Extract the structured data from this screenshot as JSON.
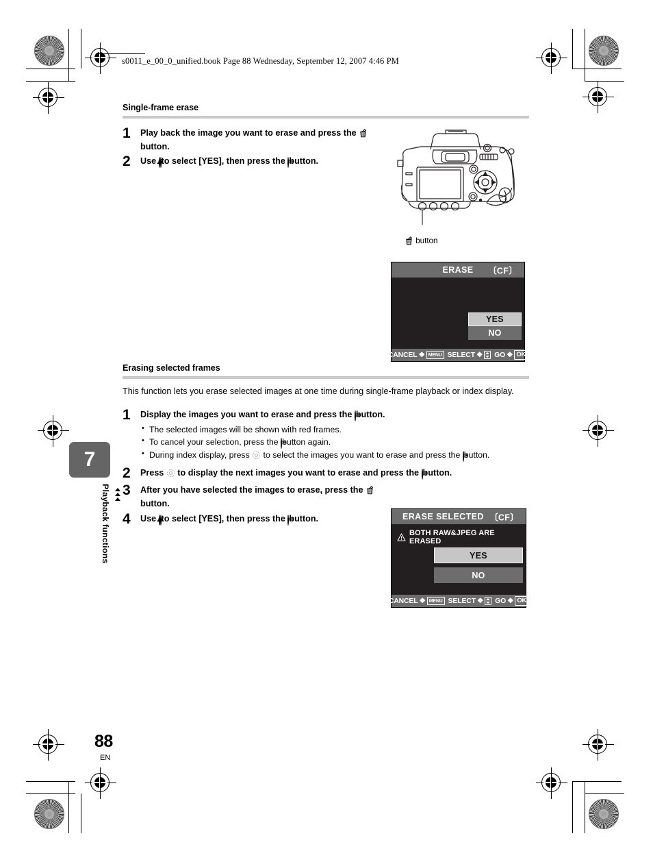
{
  "print_header": {
    "book_line": "s0011_e_00_0_unified.book  Page 88  Wednesday, September 12, 2007  4:46 PM"
  },
  "sections": [
    {
      "heading": "Single-frame erase",
      "steps": [
        {
          "num": "1",
          "text_before_icon": "Play back the image you want to erase and press the ",
          "icon": "trash-erase-icon",
          "text_after_icon": " button."
        },
        {
          "num": "2",
          "text_before_icon": "Use ",
          "icons": [
            "up-arrow-dial-icon",
            "down-arrow-dial-icon"
          ],
          "text_mid": " to select [YES], then press the ",
          "icon_end": "ok-button-icon",
          "text_after_icon": " button."
        }
      ]
    },
    {
      "heading": "Erasing selected frames",
      "intro": "This function lets you erase selected images at one time during single-frame playback or index display.",
      "steps": [
        {
          "num": "1",
          "text_before_icon": "Display the images you want to erase and press the ",
          "icon": "ok-button-icon",
          "text_after_icon": " button."
        },
        {
          "num": "2",
          "text_before_icon": "Press ",
          "icon": "arrow-pad-icon",
          "text_mid": " to display the next images you want to erase and press the ",
          "icon_end": "ok-button-icon",
          "text_after_icon": " button."
        },
        {
          "num": "3",
          "text_before_icon": "After you have selected the images to erase, press the ",
          "icon": "trash-erase-icon",
          "text_after_icon": " button."
        },
        {
          "num": "4",
          "text_before_icon": "Use ",
          "icons": [
            "up-arrow-dial-icon",
            "down-arrow-dial-icon"
          ],
          "text_mid": " to select [YES], then press the ",
          "icon_end": "ok-button-icon",
          "text_after_icon": " button."
        }
      ],
      "bullets": [
        {
          "text_before_icon": "The selected images will be shown with red frames.",
          "icon": null,
          "text_after_icon": ""
        },
        {
          "text_before_icon": "To cancel your selection, press the ",
          "icon": "ok-button-icon",
          "text_after_icon": " button again."
        },
        {
          "text_before_icon": "During index display, press ",
          "icon": "arrow-pad-icon",
          "text_mid": " to select the images you want to erase and press the ",
          "icon_end": "ok-button-icon",
          "text_after_icon": " button."
        }
      ]
    }
  ],
  "camera_figure": {
    "caption_icon": "trash-erase-icon",
    "caption_text": " button"
  },
  "lcd_screens": [
    {
      "id": "erase",
      "title": "ERASE",
      "media_badge": "CF",
      "warning": null,
      "choices": [
        {
          "label": "YES",
          "selected": true
        },
        {
          "label": "NO",
          "selected": false
        }
      ],
      "bottom_bar": [
        {
          "label": "CANCEL",
          "arrow": "❖",
          "chip": "MENU"
        },
        {
          "label": "SELECT",
          "arrow": "❖",
          "chip": "updown"
        },
        {
          "label": "GO",
          "arrow": "❖",
          "chip": "OK"
        }
      ]
    },
    {
      "id": "erase-selected",
      "title": "ERASE SELECTED",
      "media_badge": "CF",
      "warning": "BOTH RAW&JPEG ARE  ERASED",
      "warning_icon": "warning-triangle-icon",
      "choices": [
        {
          "label": "YES",
          "selected": true
        },
        {
          "label": "NO",
          "selected": false
        }
      ],
      "bottom_bar": [
        {
          "label": "CANCEL",
          "arrow": "❖",
          "chip": "MENU"
        },
        {
          "label": "SELECT",
          "arrow": "❖",
          "chip": "updown"
        },
        {
          "label": "GO",
          "arrow": "❖",
          "chip": "OK"
        }
      ]
    }
  ],
  "chapter_tab": {
    "number": "7",
    "label": "Playback functions"
  },
  "footer": {
    "page_number": "88",
    "language": "EN"
  },
  "colors": {
    "lcd_background": "#231f20",
    "lcd_bar": "#6d6d6d",
    "selected_choice": "#c6c6c6",
    "rule": "#c9c9c9",
    "chapter_tab": "#656565"
  }
}
